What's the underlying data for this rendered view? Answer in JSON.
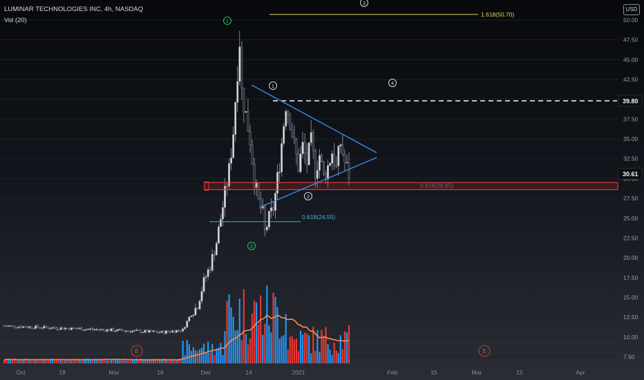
{
  "header": {
    "title": "LUMINAR TECHNOLOGIES INC, 4h, NASDAQ",
    "volume_label": "Vol (20)",
    "currency": "USD"
  },
  "colors": {
    "up": "#26a69a",
    "down": "#ef5350",
    "candle_up": "#d9dce1",
    "candle_down": "#2b2e34",
    "vol_up": "#2196f3",
    "vol_down": "#e53935",
    "vol_ma": "#ff8a50",
    "triangle": "#3d8be8",
    "fib_cyan": "#3fb3d6",
    "fib_yellow": "#e6d45a",
    "zone": "#e53935",
    "wave_green": "#22c55e",
    "wave_dark": "#1c1f25"
  },
  "chart_data": {
    "type": "candlestick",
    "ylim": [
      6.5,
      52
    ],
    "y_ticks": [
      "50.00",
      "47.50",
      "45.00",
      "42.50",
      "40.00",
      "37.50",
      "35.00",
      "32.50",
      "30.00",
      "27.50",
      "25.00",
      "22.50",
      "20.00",
      "17.50",
      "15.00",
      "12.50",
      "10.00",
      "7.50"
    ],
    "x_ticks": [
      "Oct",
      "19",
      "Nov",
      "16",
      "Dec",
      "14",
      "2021",
      "Feb",
      "15",
      "Mar",
      "15",
      "Apr"
    ],
    "price_labels": [
      {
        "value": 39.8,
        "text": "39.80",
        "style": "dark"
      },
      {
        "value": 30.61,
        "text": "30.61",
        "style": "dark"
      }
    ],
    "resistance": {
      "value": 39.8
    },
    "fib_levels": [
      {
        "text": "1.618(50.70)",
        "value": 50.7
      },
      {
        "text": "0.618(24.55)",
        "value": 24.55
      },
      {
        "text": "0.618(28.85)",
        "value": 28.85
      }
    ],
    "zone": {
      "low": 28.6,
      "high": 29.5
    },
    "waves": [
      {
        "label": "1",
        "color": "green"
      },
      {
        "label": "2",
        "color": "green"
      },
      {
        "label": "3",
        "color": "dark"
      },
      {
        "label": "1",
        "color": "dark"
      },
      {
        "label": "2",
        "color": "dark"
      },
      {
        "label": "4",
        "color": "dark"
      }
    ],
    "events": [
      "E",
      "E"
    ],
    "volume_ma_label": "Vol (20)"
  }
}
